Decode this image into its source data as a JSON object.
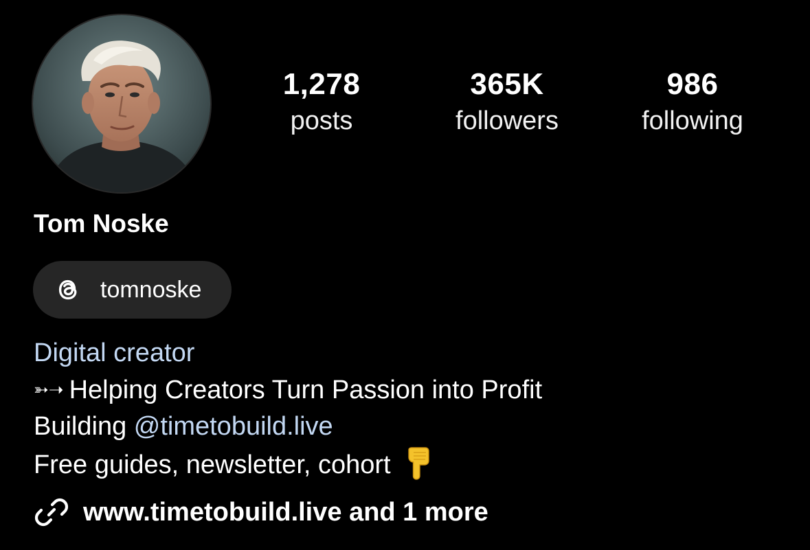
{
  "profile": {
    "name": "Tom Noske",
    "avatar_icon": "profile-photo"
  },
  "stats": {
    "posts": {
      "value": "1,278",
      "label": "posts"
    },
    "followers": {
      "value": "365K",
      "label": "followers"
    },
    "following": {
      "value": "986",
      "label": "following"
    }
  },
  "threads": {
    "icon": "threads-icon",
    "handle": "tomnoske"
  },
  "bio": {
    "category": "Digital creator",
    "line1_prefix": "➳➝",
    "line1": "Helping Creators Turn Passion into Profit",
    "line2_text": "Building ",
    "line2_mention": "@timetobuild.live",
    "line3": "Free guides, newsletter, cohort",
    "line3_emoji": "pointing-down-hand-emoji"
  },
  "link": {
    "icon": "link-icon",
    "text": "www.timetobuild.live and 1 more"
  },
  "colors": {
    "background": "#000000",
    "text": "#ffffff",
    "accent_link": "#c3d8f3",
    "pill_bg": "#262626"
  }
}
